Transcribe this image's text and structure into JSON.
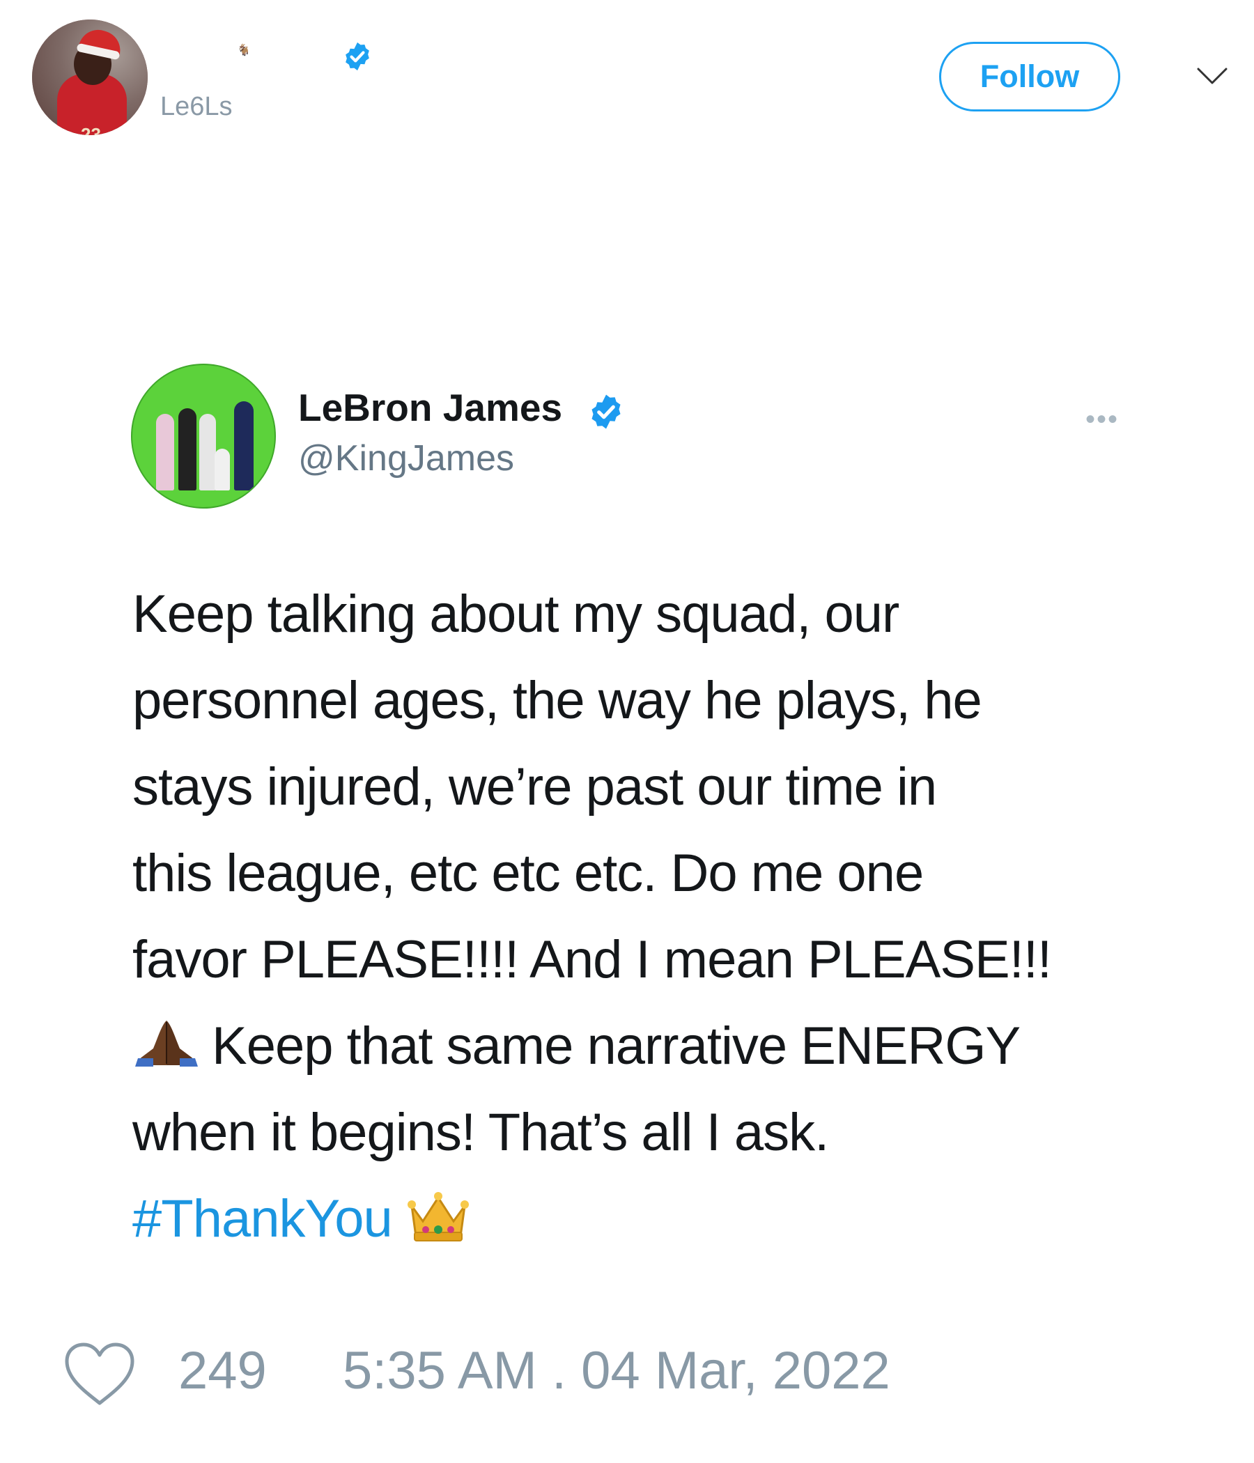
{
  "outer_tweet": {
    "handle": "Le6Ls",
    "tiny_emoji": "🐐",
    "follow_label": "Follow",
    "verified_icon": "verified-badge-icon",
    "more_icon": "chevron-down-icon"
  },
  "embedded_tweet": {
    "name": "LeBron James",
    "handle": "@KingJames",
    "more_label": "•••",
    "lines": [
      "Keep talking about my squad, our",
      "personnel ages, the way he plays, he",
      "stays injured, we’re past our time in",
      "this league, etc etc etc. Do me one",
      "favor PLEASE!!!! And I mean PLEASE!!!",
      "Keep that same narrative ENERGY",
      "when it begins! That’s all I ask."
    ],
    "hashtag": "#ThankYou",
    "emojis": [
      "praying-hands-emoji",
      "crown-emoji"
    ]
  },
  "footer": {
    "like_count": "249",
    "timestamp": "5:35 AM . 04 Mar, 2022"
  },
  "colors": {
    "accent": "#1da1f2",
    "hashtag": "#1b95e0",
    "muted": "#8899a6"
  }
}
